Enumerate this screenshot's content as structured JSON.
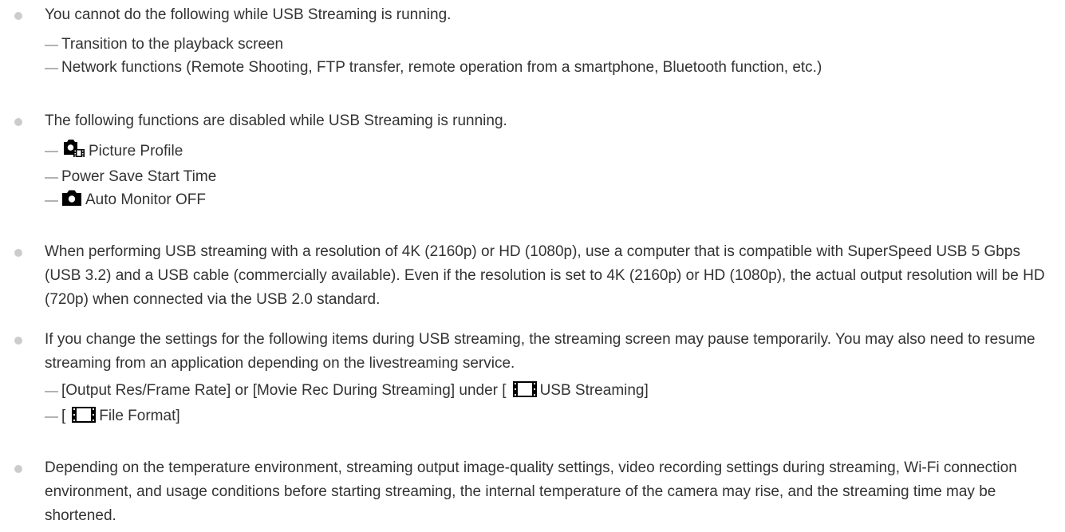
{
  "notes": [
    {
      "text": "You cannot do the following while USB Streaming is running.",
      "items": [
        "Transition to the playback screen",
        "Network functions (Remote Shooting, FTP transfer, remote operation from a smartphone, Bluetooth function, etc.)"
      ]
    },
    {
      "text": "The following functions are disabled while USB Streaming is running.",
      "items": [
        "Picture Profile",
        "Power Save Start Time",
        "Auto Monitor OFF"
      ]
    },
    {
      "text": "When performing USB streaming with a resolution of 4K (2160p) or HD (1080p), use a computer that is compatible with SuperSpeed USB 5 Gbps (USB 3.2) and a USB cable (commercially available). Even if the resolution is set to 4K (2160p) or HD (1080p), the actual output resolution will be HD (720p) when connected via the USB 2.0 standard."
    },
    {
      "text": "If you change the settings for the following items during USB streaming, the streaming screen may pause temporarily. You may also need to resume streaming from an application depending on the livestreaming service.",
      "items": [
        {
          "before": "[Output Res/Frame Rate] or [Movie Rec During Streaming] under [",
          "after": "USB Streaming]"
        },
        {
          "before": "[",
          "after": "File Format]"
        }
      ]
    },
    {
      "text": "Depending on the temperature environment, streaming output image-quality settings, video recording settings during streaming, Wi-Fi connection environment, and usage conditions before starting streaming, the internal temperature of the camera may rise, and the streaming time may be shortened."
    }
  ],
  "icons": {
    "still_movie_camera": "still-movie-camera-icon",
    "still_camera": "still-camera-icon",
    "movie_film": "movie-film-icon"
  },
  "colors": {
    "text": "#333333",
    "bullet": "#cccccc",
    "dash": "#b3b3b3",
    "icon": "#000000"
  }
}
